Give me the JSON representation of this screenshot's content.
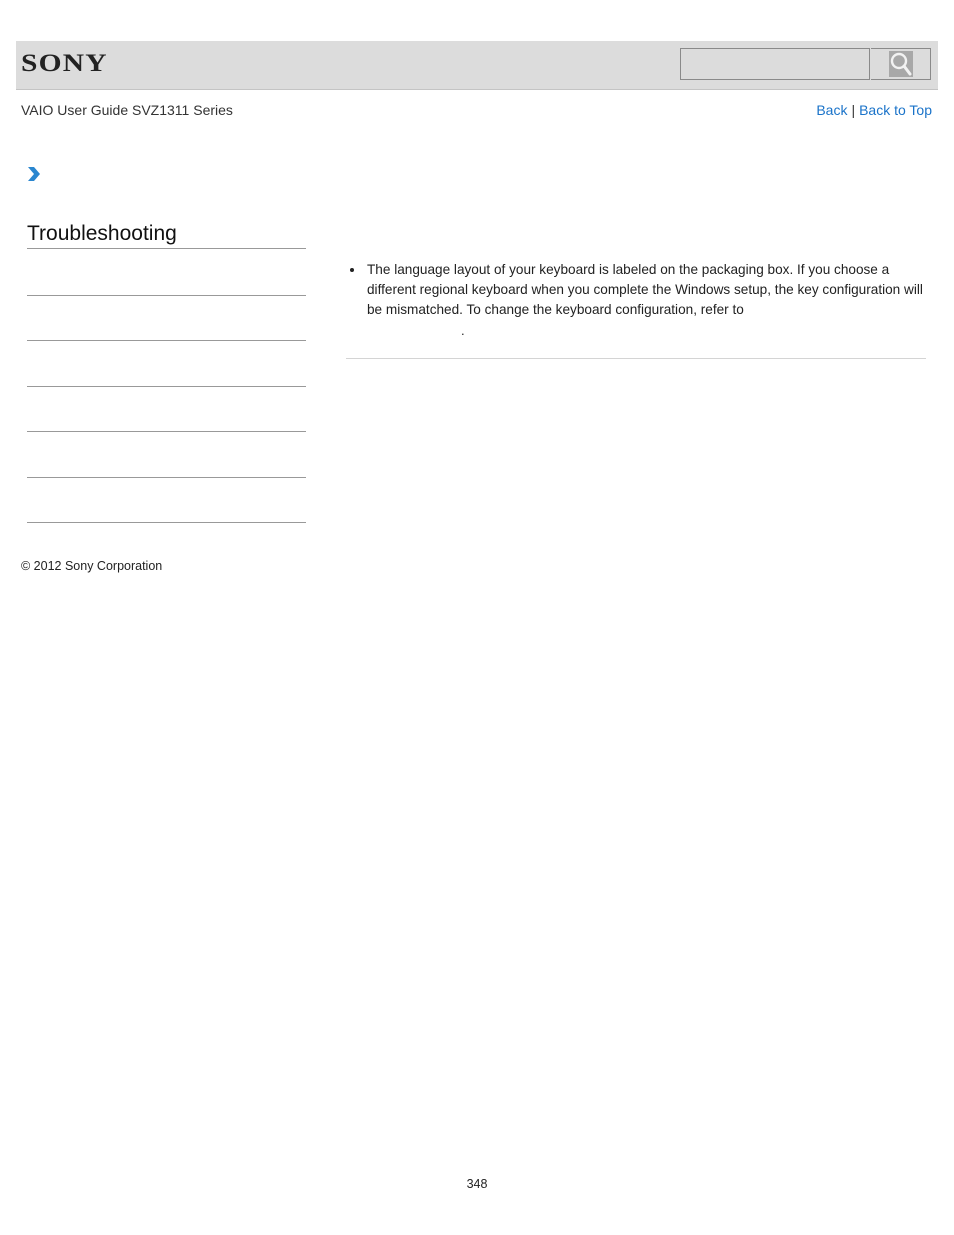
{
  "header": {
    "logo": "SONY",
    "search": {
      "placeholder": "",
      "value": "",
      "button_icon": "search-icon"
    }
  },
  "guide_title": "VAIO User Guide SVZ1311 Series",
  "top_nav": {
    "back": "Back",
    "separator": "|",
    "back_to_top": "Back to Top"
  },
  "breadcrumb": {
    "icon": "chevron-right-icon"
  },
  "sidebar": {
    "section_title": "Troubleshooting",
    "items": [
      {
        "label": ""
      },
      {
        "label": ""
      },
      {
        "label": ""
      },
      {
        "label": ""
      },
      {
        "label": ""
      },
      {
        "label": ""
      }
    ]
  },
  "main": {
    "bullets": [
      {
        "text": "The language layout of your keyboard is labeled on the packaging box. If you choose a different regional keyboard when you complete the Windows setup, the key configuration will be mismatched. To change the keyboard configuration, refer to",
        "trailing": "."
      }
    ]
  },
  "footer": {
    "copyright": "© 2012 Sony Corporation",
    "page_number": "348"
  },
  "colors": {
    "header_bg": "#dcdcdc",
    "link": "#1a73c9",
    "chevron": "#2a86cf"
  }
}
